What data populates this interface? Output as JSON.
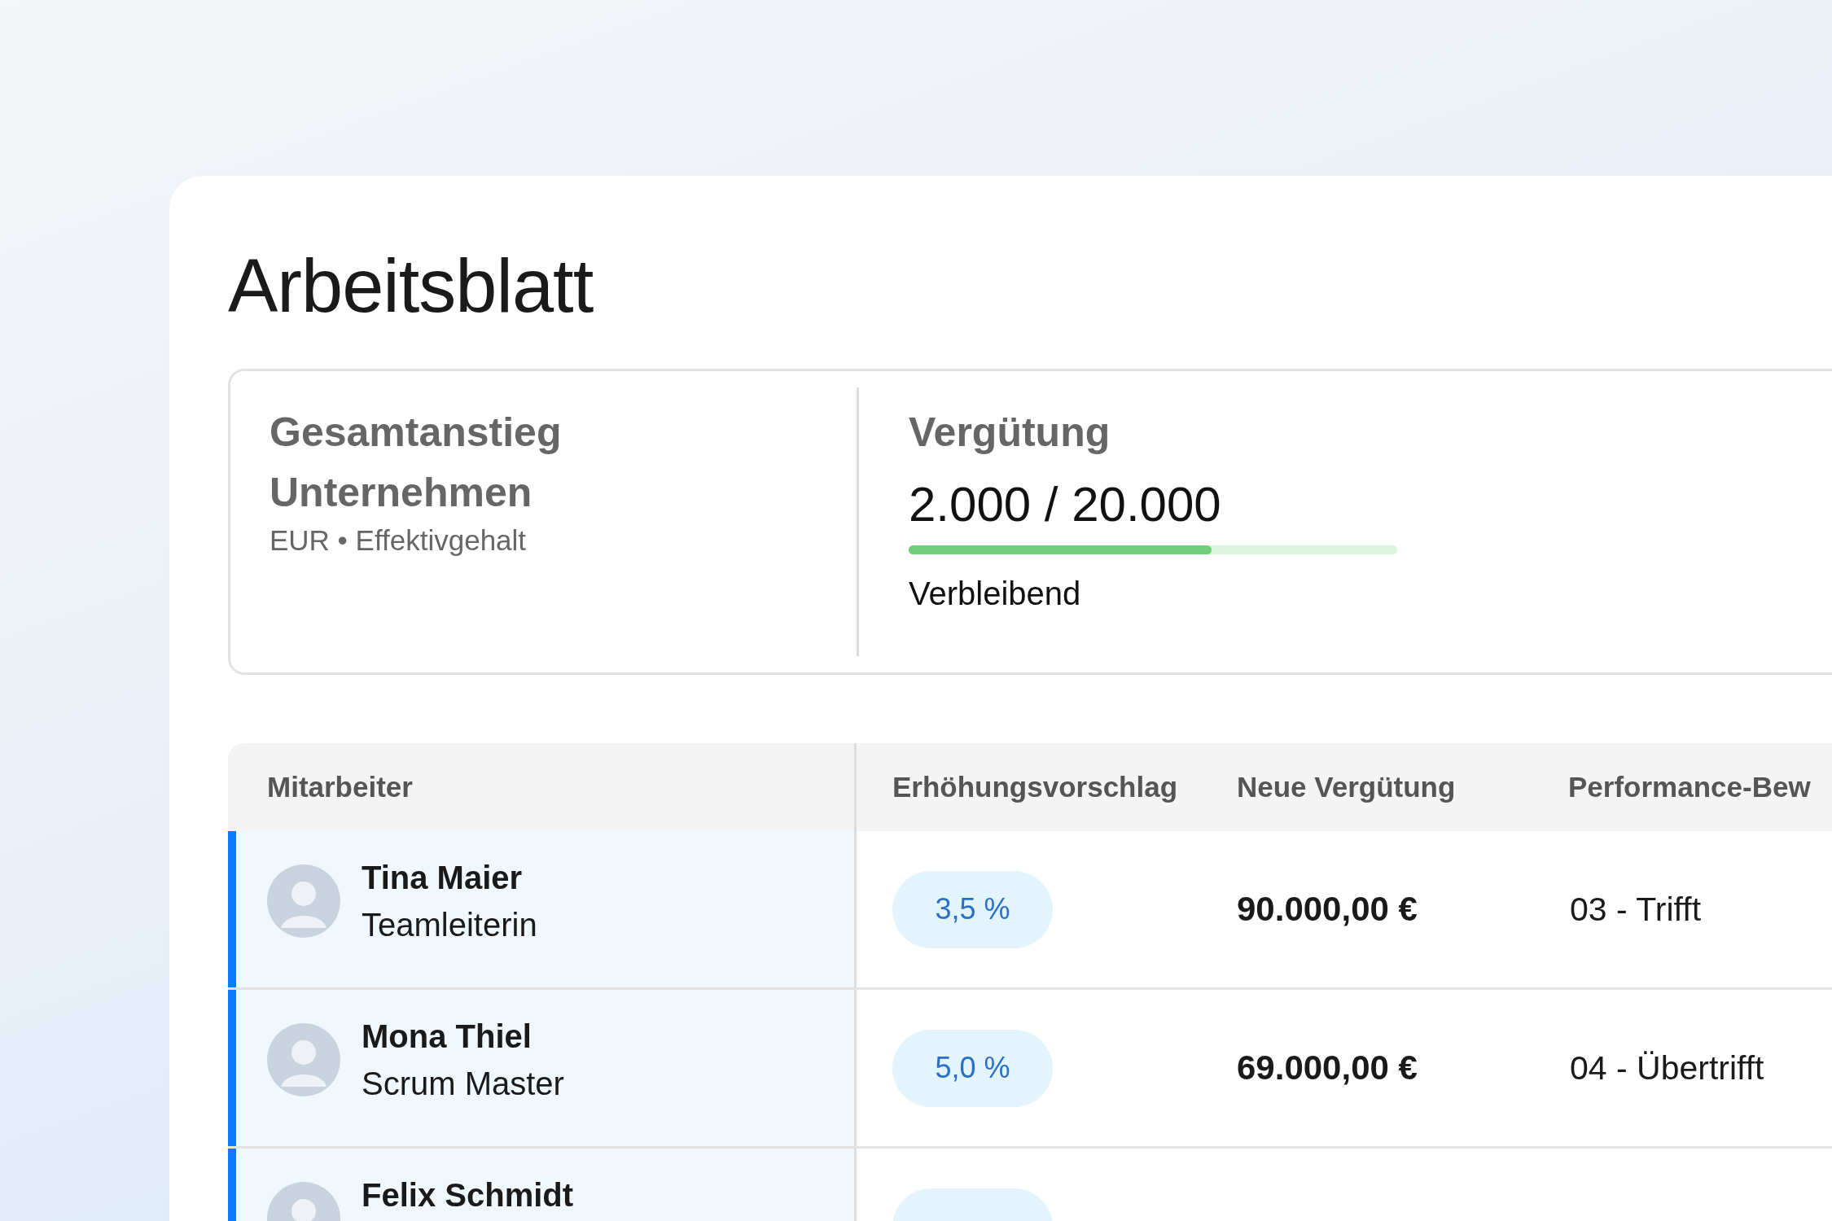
{
  "page": {
    "title": "Arbeitsblatt"
  },
  "summary": {
    "title": "Gesamtanstieg Unternehmen",
    "subtitle": "EUR • Effektivgehalt",
    "budget": {
      "title": "Vergütung",
      "value": "2.000 / 20.000",
      "level": 0.62,
      "caption": "Verbleibend"
    }
  },
  "table": {
    "columns": [
      "Mitarbeiter",
      "Erhöhungsvorschlag",
      "Neue Vergütung",
      "Performance-Bew"
    ],
    "rows": [
      {
        "name": "Tina Maier",
        "role": "Teamleiterin",
        "selected": true,
        "raise": "3,5 %",
        "new_salary": "90.000,00 €",
        "rating": "03 - Trifft"
      },
      {
        "name": "Mona Thiel",
        "role": "Scrum Master",
        "selected": true,
        "raise": "5,0 %",
        "new_salary": "69.000,00 €",
        "rating": "04 - Übertrifft"
      },
      {
        "name": "Felix Schmidt",
        "selected": true
      }
    ]
  }
}
